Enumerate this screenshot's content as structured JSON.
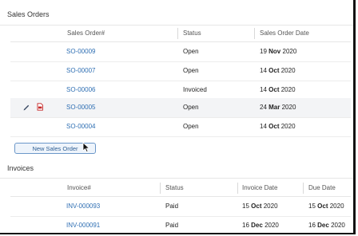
{
  "sales_orders": {
    "title": "Sales Orders",
    "columns": [
      "Sales Order#",
      "Status",
      "Sales Order Date"
    ],
    "rows": [
      {
        "id": "SO-00009",
        "status": "Open",
        "day": "19",
        "month": "Nov",
        "year": "2020"
      },
      {
        "id": "SO-00007",
        "status": "Open",
        "day": "14",
        "month": "Oct",
        "year": "2020"
      },
      {
        "id": "SO-00006",
        "status": "Invoiced",
        "day": "14",
        "month": "Oct",
        "year": "2020"
      },
      {
        "id": "SO-00005",
        "status": "Open",
        "day": "24",
        "month": "Mar",
        "year": "2020"
      },
      {
        "id": "SO-00004",
        "status": "Open",
        "day": "14",
        "month": "Oct",
        "year": "2020"
      }
    ],
    "new_button_label": "New Sales Order"
  },
  "invoices": {
    "title": "Invoices",
    "columns": [
      "Invoice#",
      "Status",
      "Invoice Date",
      "Due Date"
    ],
    "rows": [
      {
        "id": "INV-000093",
        "status": "Paid",
        "inv_day": "15",
        "inv_month": "Oct",
        "inv_year": "2020",
        "due_day": "15",
        "due_month": "Oct",
        "due_year": "2020"
      },
      {
        "id": "INV-000091",
        "status": "Paid",
        "inv_day": "16",
        "inv_month": "Dec",
        "inv_year": "2020",
        "due_day": "16",
        "due_month": "Dec",
        "due_year": "2020"
      }
    ]
  },
  "colors": {
    "link": "#2f6fb3",
    "button_border": "#6b97c9",
    "hover_row": "#f3f4f6"
  },
  "icons": {
    "edit": "pencil-icon",
    "pdf": "pdf-icon",
    "cursor": "mouse-pointer-icon"
  }
}
